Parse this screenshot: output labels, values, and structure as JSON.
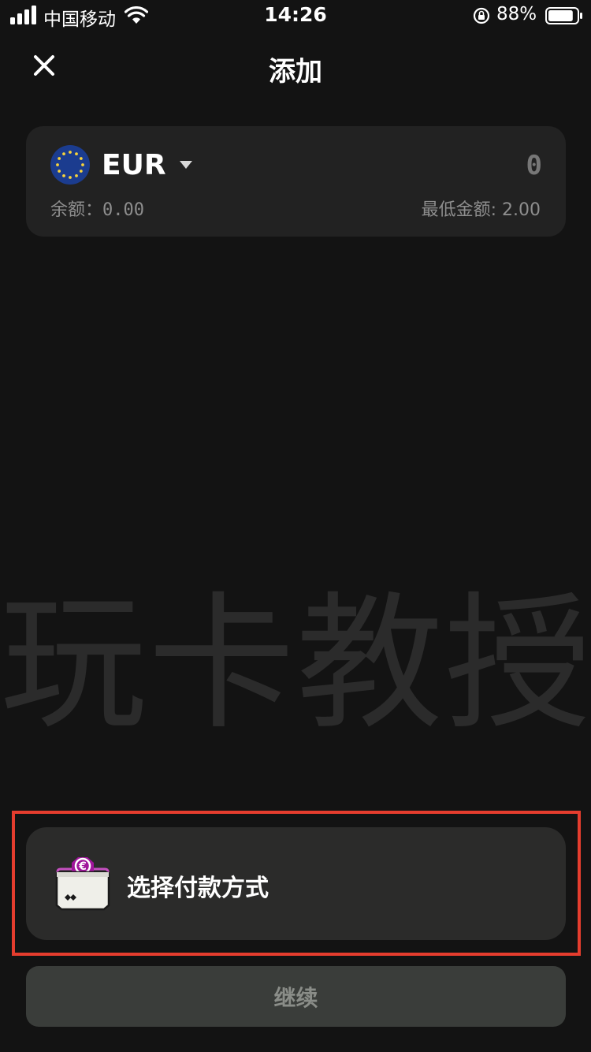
{
  "status_bar": {
    "carrier": "中国移动",
    "time": "14:26",
    "battery_percent": "88%",
    "battery_level": 0.88,
    "icons": [
      "signal-icon",
      "wifi-icon",
      "rotation-lock-icon",
      "battery-icon"
    ]
  },
  "header": {
    "title": "添加",
    "close_icon": "close-icon"
  },
  "currency_card": {
    "currency": "EUR",
    "flag_icon": "eu-flag-icon",
    "amount_placeholder": "0",
    "balance_label": "余额：",
    "balance_value": "0.00",
    "min_amount": "最低金额: 2.00"
  },
  "watermark": "玩卡教授",
  "payment": {
    "label": "选择付款方式",
    "icon": "euro-wallet-icon"
  },
  "continue_label": "继续",
  "colors": {
    "background": "#131313",
    "card": "#222222",
    "payment_card": "#2b2b2a",
    "highlight": "#e53d2e",
    "euro_badge": "#a0159b",
    "continue_bg": "#3a3d3a"
  }
}
